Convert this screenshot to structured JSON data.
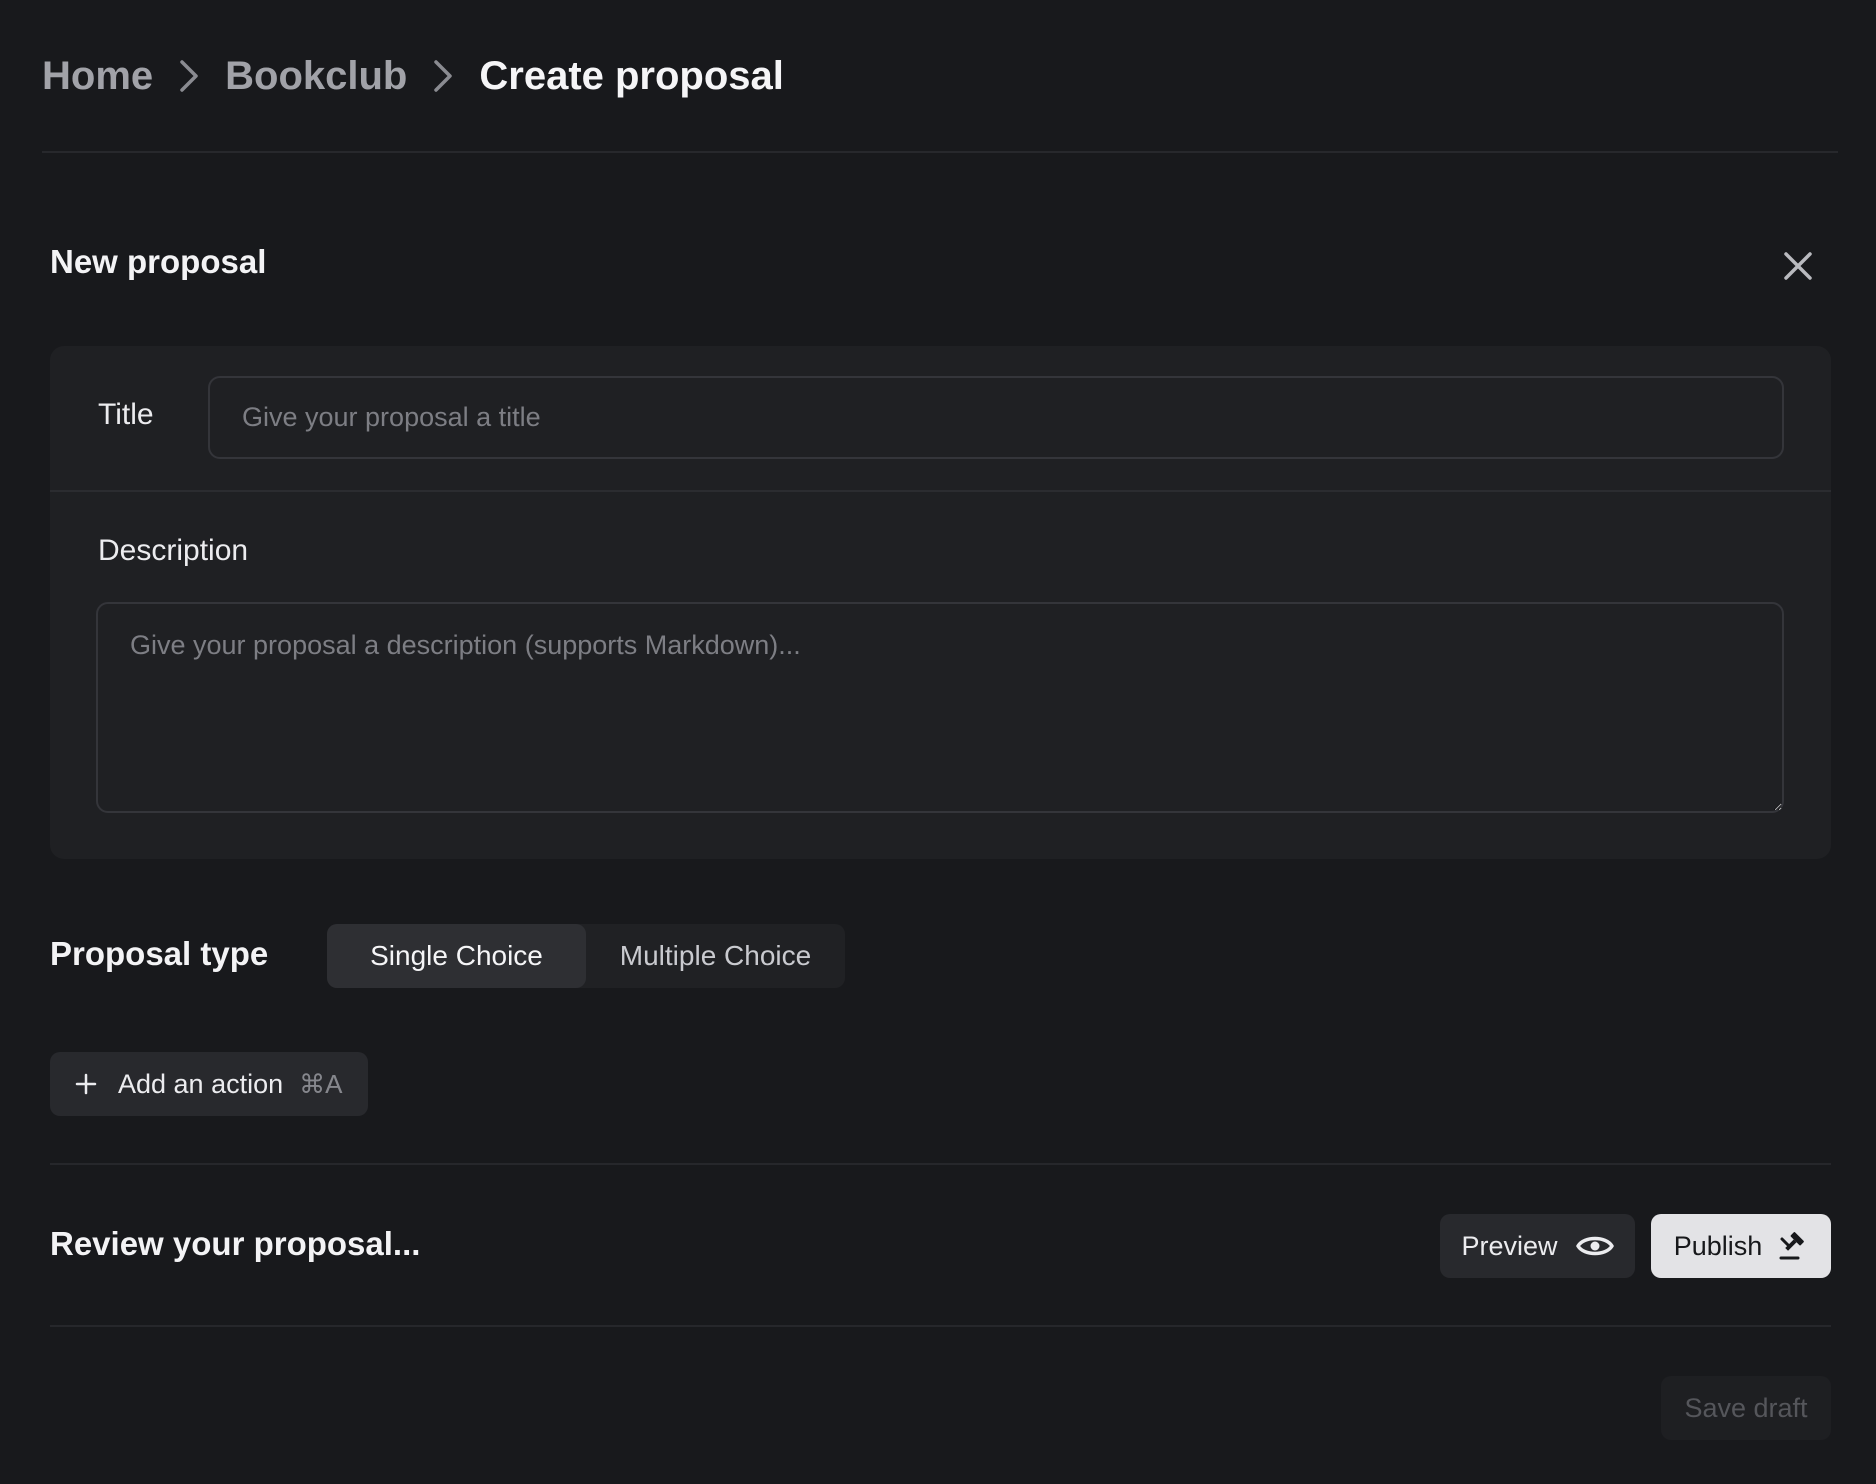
{
  "breadcrumb": {
    "items": [
      "Home",
      "Bookclub",
      "Create proposal"
    ]
  },
  "form": {
    "heading": "New proposal",
    "close_icon": "close-icon",
    "title_label": "Title",
    "title_placeholder": "Give your proposal a title",
    "title_value": "",
    "description_label": "Description",
    "description_placeholder": "Give your proposal a description (supports Markdown)...",
    "description_value": ""
  },
  "proposal_type": {
    "label": "Proposal type",
    "options": [
      "Single Choice",
      "Multiple Choice"
    ],
    "selected": "Single Choice"
  },
  "add_action": {
    "label": "Add an action",
    "shortcut": "⌘A",
    "icon": "plus-icon"
  },
  "review": {
    "label": "Review your proposal...",
    "preview_label": "Preview",
    "preview_icon": "eye-icon",
    "publish_label": "Publish",
    "publish_icon": "gavel-icon"
  },
  "footer": {
    "save_draft_label": "Save draft"
  },
  "colors": {
    "background": "#18191c",
    "card": "#1f2023",
    "publish_bg": "#e3e3e6"
  }
}
